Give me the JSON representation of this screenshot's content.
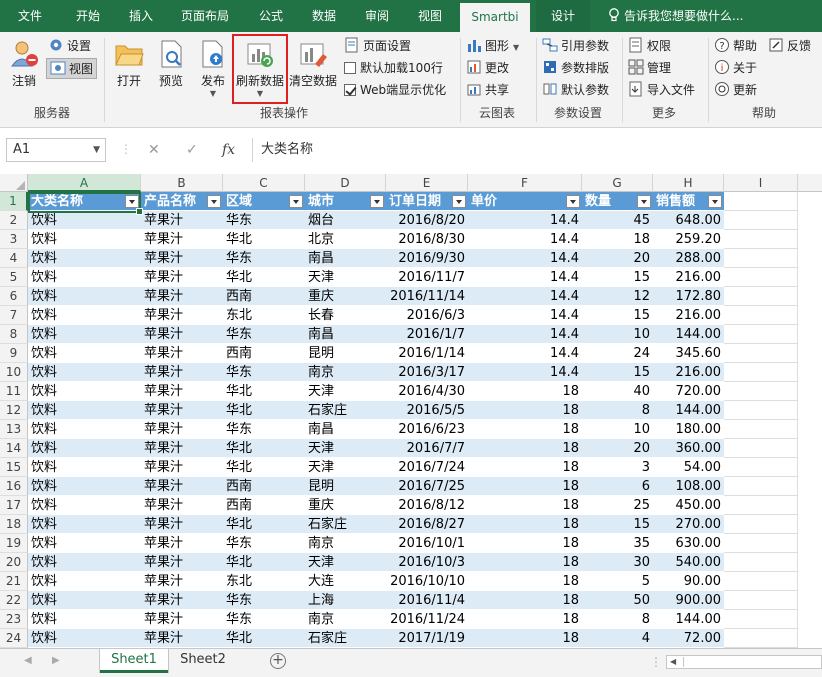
{
  "tabs": [
    "文件",
    "开始",
    "插入",
    "页面布局",
    "公式",
    "数据",
    "审阅",
    "视图",
    "Smartbi",
    "设计"
  ],
  "active_tab": "Smartbi",
  "tell_me": "告诉我您想要做什么...",
  "ribbon": {
    "server": {
      "label": "服务器",
      "logout": "注销",
      "settings": "设置",
      "view": "视图"
    },
    "report": {
      "label": "报表操作",
      "open": "打开",
      "preview": "预览",
      "publish": "发布",
      "refresh": "刷新数据",
      "clear": "清空数据",
      "page_setup": "页面设置",
      "default_load": "默认加载100行",
      "web_optimize": "Web端显示优化"
    },
    "cloud": {
      "label": "云图表",
      "chart": "图形",
      "update": "更改",
      "share": "共享"
    },
    "params": {
      "label": "参数设置",
      "ref": "引用参数",
      "layout": "参数排版",
      "default": "默认参数"
    },
    "more": {
      "label": "更多",
      "permission": "权限",
      "manage": "管理",
      "import": "导入文件"
    },
    "help": {
      "label": "帮助",
      "help": "帮助",
      "feedback": "反馈",
      "about": "关于",
      "update": "更新"
    }
  },
  "formula_bar": {
    "cell_ref": "A1",
    "content": "大类名称",
    "fx": "fx"
  },
  "columns": [
    "A",
    "B",
    "C",
    "D",
    "E",
    "F",
    "G",
    "H",
    "I"
  ],
  "headers": [
    "大类名称",
    "产品名称",
    "区域",
    "城市",
    "订单日期",
    "单价",
    "数量",
    "销售额"
  ],
  "rows": [
    [
      "饮料",
      "苹果汁",
      "华东",
      "烟台",
      "2016/8/20",
      "14.4",
      "45",
      "648.00"
    ],
    [
      "饮料",
      "苹果汁",
      "华北",
      "北京",
      "2016/8/30",
      "14.4",
      "18",
      "259.20"
    ],
    [
      "饮料",
      "苹果汁",
      "华东",
      "南昌",
      "2016/9/30",
      "14.4",
      "20",
      "288.00"
    ],
    [
      "饮料",
      "苹果汁",
      "华北",
      "天津",
      "2016/11/7",
      "14.4",
      "15",
      "216.00"
    ],
    [
      "饮料",
      "苹果汁",
      "西南",
      "重庆",
      "2016/11/14",
      "14.4",
      "12",
      "172.80"
    ],
    [
      "饮料",
      "苹果汁",
      "东北",
      "长春",
      "2016/6/3",
      "14.4",
      "15",
      "216.00"
    ],
    [
      "饮料",
      "苹果汁",
      "华东",
      "南昌",
      "2016/1/7",
      "14.4",
      "10",
      "144.00"
    ],
    [
      "饮料",
      "苹果汁",
      "西南",
      "昆明",
      "2016/1/14",
      "14.4",
      "24",
      "345.60"
    ],
    [
      "饮料",
      "苹果汁",
      "华东",
      "南京",
      "2016/3/17",
      "14.4",
      "15",
      "216.00"
    ],
    [
      "饮料",
      "苹果汁",
      "华北",
      "天津",
      "2016/4/30",
      "18",
      "40",
      "720.00"
    ],
    [
      "饮料",
      "苹果汁",
      "华北",
      "石家庄",
      "2016/5/5",
      "18",
      "8",
      "144.00"
    ],
    [
      "饮料",
      "苹果汁",
      "华东",
      "南昌",
      "2016/6/23",
      "18",
      "10",
      "180.00"
    ],
    [
      "饮料",
      "苹果汁",
      "华北",
      "天津",
      "2016/7/7",
      "18",
      "20",
      "360.00"
    ],
    [
      "饮料",
      "苹果汁",
      "华北",
      "天津",
      "2016/7/24",
      "18",
      "3",
      "54.00"
    ],
    [
      "饮料",
      "苹果汁",
      "西南",
      "昆明",
      "2016/7/25",
      "18",
      "6",
      "108.00"
    ],
    [
      "饮料",
      "苹果汁",
      "西南",
      "重庆",
      "2016/8/12",
      "18",
      "25",
      "450.00"
    ],
    [
      "饮料",
      "苹果汁",
      "华北",
      "石家庄",
      "2016/8/27",
      "18",
      "15",
      "270.00"
    ],
    [
      "饮料",
      "苹果汁",
      "华东",
      "南京",
      "2016/10/1",
      "18",
      "35",
      "630.00"
    ],
    [
      "饮料",
      "苹果汁",
      "华北",
      "天津",
      "2016/10/3",
      "18",
      "30",
      "540.00"
    ],
    [
      "饮料",
      "苹果汁",
      "东北",
      "大连",
      "2016/10/10",
      "18",
      "5",
      "90.00"
    ],
    [
      "饮料",
      "苹果汁",
      "华东",
      "上海",
      "2016/11/4",
      "18",
      "50",
      "900.00"
    ],
    [
      "饮料",
      "苹果汁",
      "华东",
      "南京",
      "2016/11/24",
      "18",
      "8",
      "144.00"
    ],
    [
      "饮料",
      "苹果汁",
      "华北",
      "石家庄",
      "2017/1/19",
      "18",
      "4",
      "72.00"
    ]
  ],
  "sheets": [
    "Sheet1",
    "Sheet2"
  ],
  "active_sheet": "Sheet1",
  "colors": {
    "excel_green": "#217346",
    "header_blue": "#5b9bd5",
    "band_blue": "#ddebf7",
    "highlight_red": "#e02020"
  }
}
